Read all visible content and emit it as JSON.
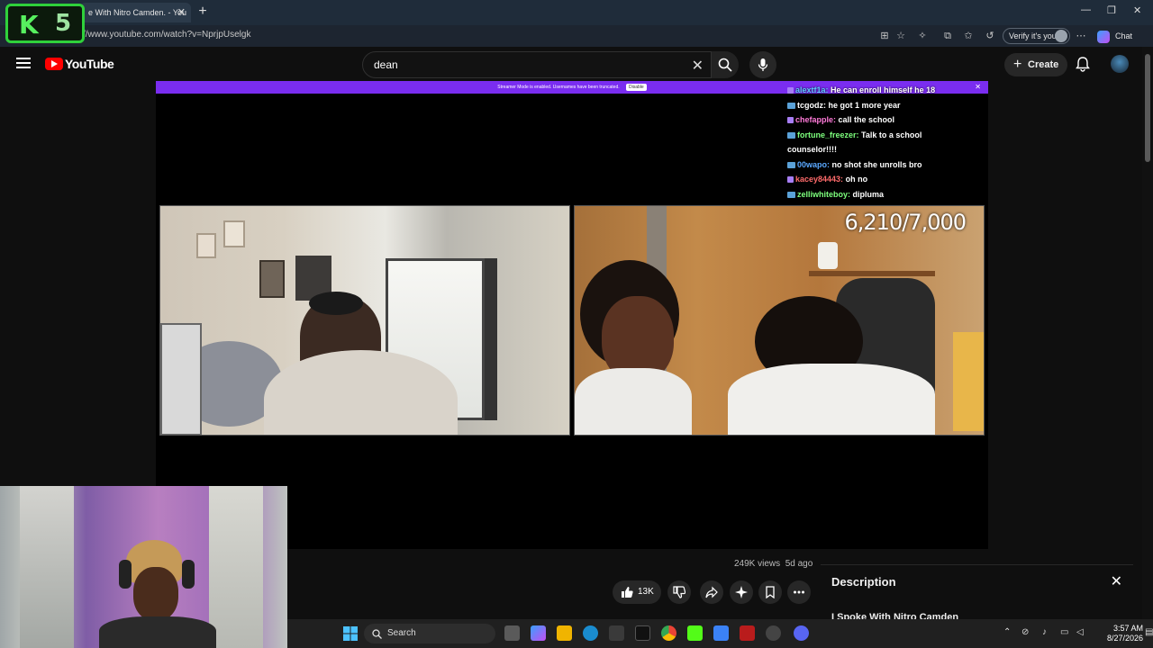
{
  "browser": {
    "tab_title": "e With Nitro Camden. - You",
    "url": "//www.youtube.com/watch?v=NprjpUselgk",
    "verify_label": "Verify it's you",
    "chat_label": "Chat"
  },
  "overlay_logo": {
    "k": "K",
    "num": "5"
  },
  "youtube": {
    "logo_text": "YouTube",
    "search_value": "dean",
    "create_label": "Create"
  },
  "stream": {
    "banner_text": "Streamer Mode is enabled. Usernames have been truncated.",
    "banner_button": "Disable",
    "counter": "6,210/7,000",
    "chat": [
      {
        "user": "alextf1a:",
        "color": "#5ec8ff",
        "msg": "He can enroll himself he 18"
      },
      {
        "user": "tcgodz:",
        "color": "#ffffff",
        "msg": "he got 1 more year"
      },
      {
        "user": "chefapple:",
        "color": "#ff7ad9",
        "msg": "call the school"
      },
      {
        "user": "fortune_freezer:",
        "color": "#7dff7d",
        "msg": "Talk to a school"
      },
      {
        "user": "counselor!!!!",
        "color": "#ffffff",
        "msg": ""
      },
      {
        "user": "00wapo:",
        "color": "#5aa8ff",
        "msg": "no shot she unrolls bro"
      },
      {
        "user": "kacey84443:",
        "color": "#ff6b6b",
        "msg": "oh no"
      },
      {
        "user": "zelliwhiteboy:",
        "color": "#7dff7d",
        "msg": "dipluma"
      }
    ]
  },
  "video_info": {
    "views": "249K views",
    "age": "5d ago",
    "likes": "13K"
  },
  "description": {
    "title": "Description",
    "subtitle": "I Spoke With Nitro Camden"
  },
  "taskbar": {
    "search_label": "Search",
    "time": "3:57 AM",
    "date": "8/27/2026"
  }
}
